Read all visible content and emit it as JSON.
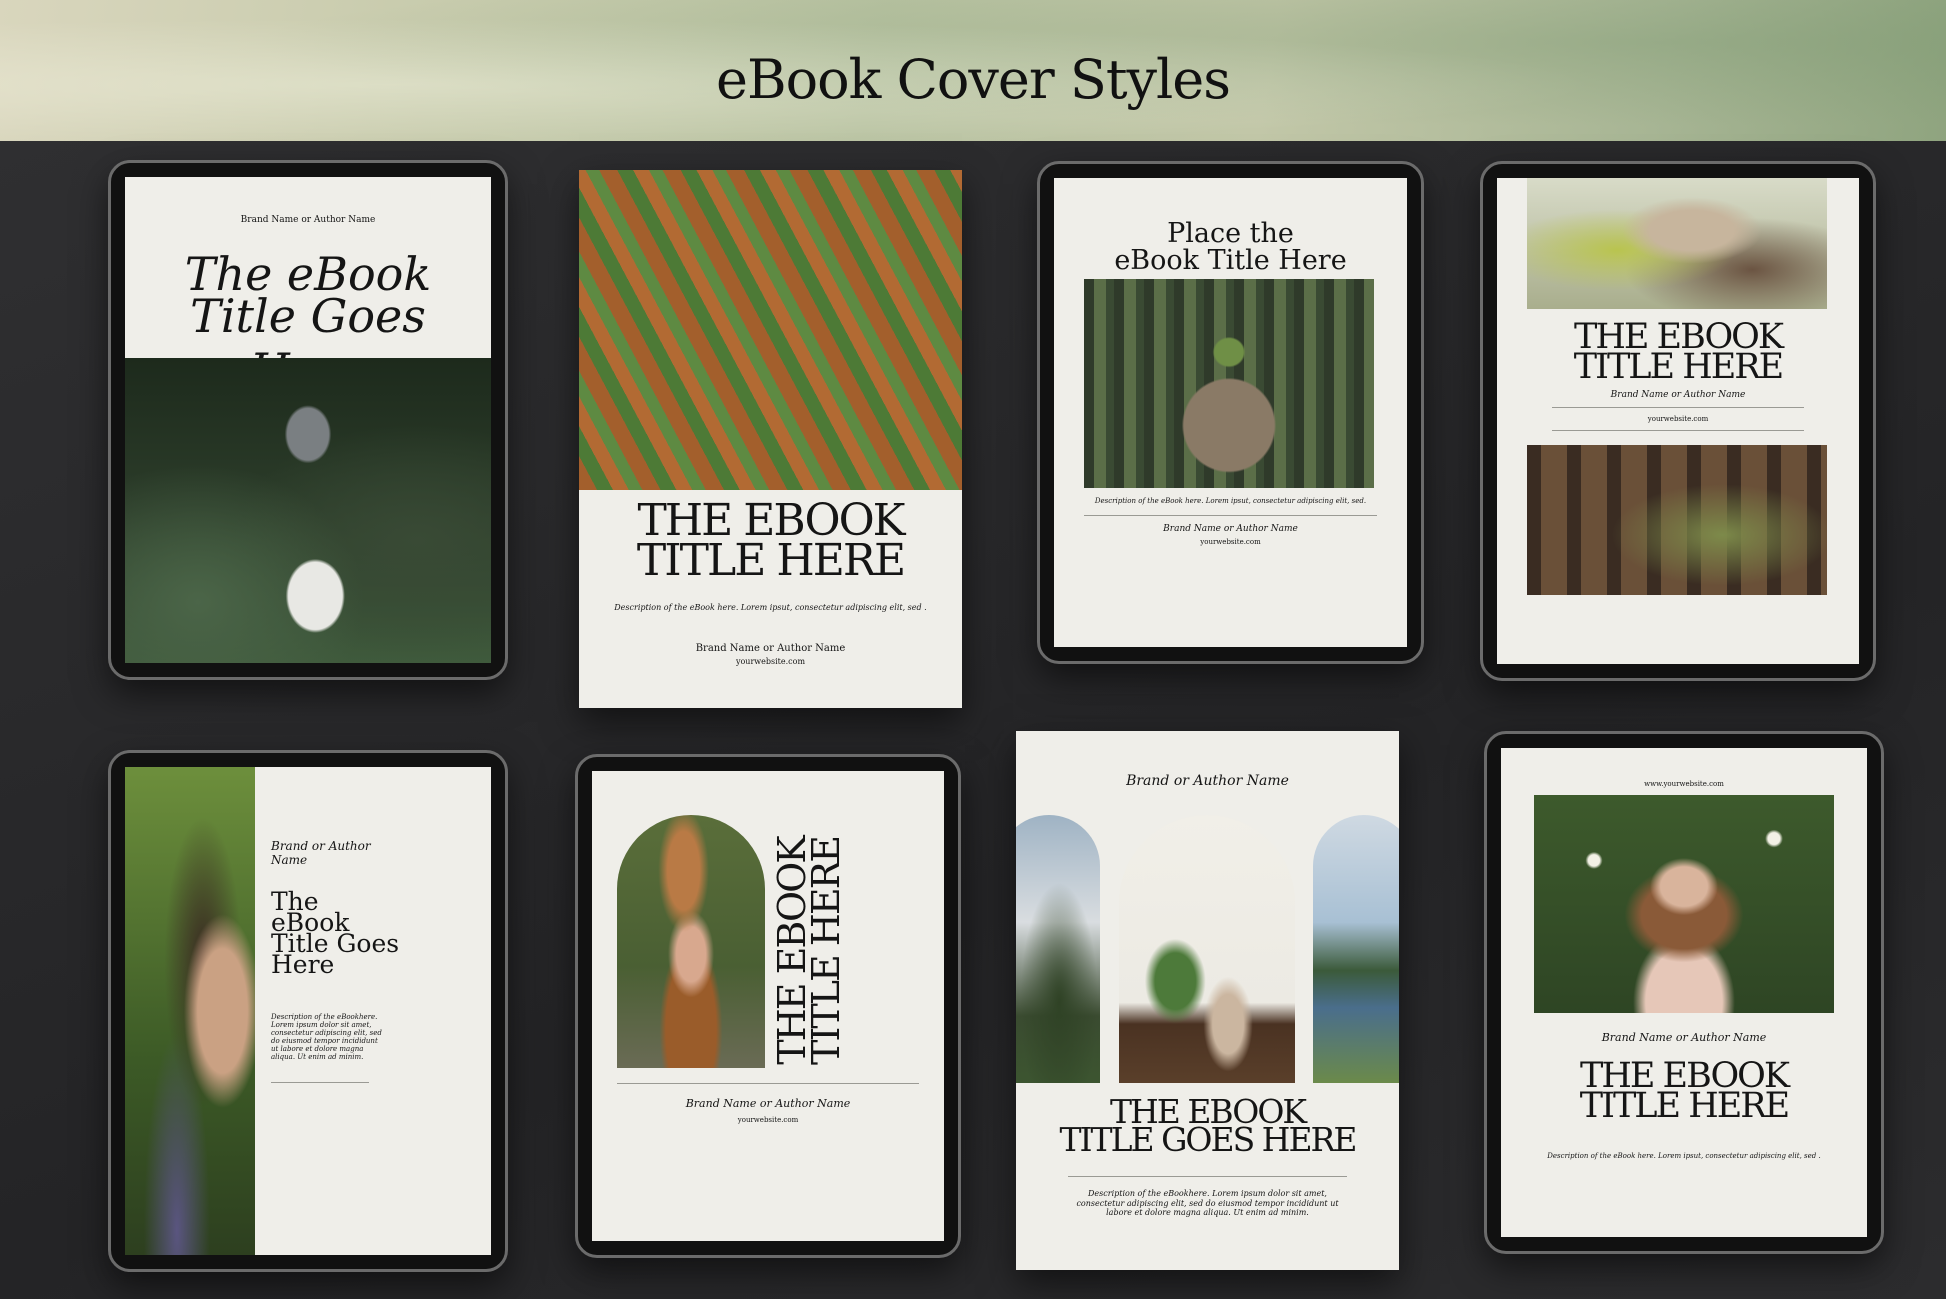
{
  "page_title": "eBook Cover Styles",
  "cover1": {
    "brand": "Brand Name or Author Name",
    "title_l1": "The eBook",
    "title_l2": "Title Goes Here"
  },
  "cover2": {
    "title_l1": "THE EBOOK",
    "title_l2": "TITLE HERE",
    "description": "Description of the eBook here. Lorem ipsut, consectetur adipiscing elit, sed .",
    "brand": "Brand Name or Author Name",
    "website": "yourwebsite.com"
  },
  "cover3": {
    "title_l1": "Place the",
    "title_l2": "eBook Title Here",
    "description": "Description of the eBook here. Lorem ipsut, consectetur adipiscing elit, sed.",
    "brand": "Brand Name or Author Name",
    "website": "yourwebsite.com"
  },
  "cover4": {
    "title_l1": "THE EBOOK",
    "title_l2": "TITLE HERE",
    "brand": "Brand Name or Author Name",
    "website": "yourwebsite.com"
  },
  "cover5": {
    "brand_l1": "Brand or Author",
    "brand_l2": "Name",
    "title_l1": "The",
    "title_l2": "eBook",
    "title_l3": "Title Goes",
    "title_l4": "Here",
    "description": "Description of the eBookhere. Lorem ipsum dolor sit amet, consectetur adipiscing elit, sed do eiusmod tempor incididunt ut labore et dolore magna aliqua. Ut enim ad minim."
  },
  "cover6": {
    "title_l1": "THE EBOOK",
    "title_l2": "TITLE HERE",
    "brand": "Brand Name or Author Name",
    "website": "yourwebsite.com"
  },
  "cover7": {
    "brand": "Brand or Author Name",
    "title_l1": "THE EBOOK",
    "title_l2": "TITLE GOES HERE",
    "description": "Description of the eBookhere. Lorem ipsum dolor sit amet, consectetur adipiscing elit, sed do eiusmod tempor incididunt ut labore et dolore magna aliqua. Ut enim ad minim."
  },
  "cover8": {
    "website": "www.yourwebsite.com",
    "brand": "Brand Name or Author Name",
    "title_l1": "THE EBOOK",
    "title_l2": "TITLE HERE",
    "description": "Description of the eBook here. Lorem ipsut, consectetur adipiscing elit, sed ."
  }
}
